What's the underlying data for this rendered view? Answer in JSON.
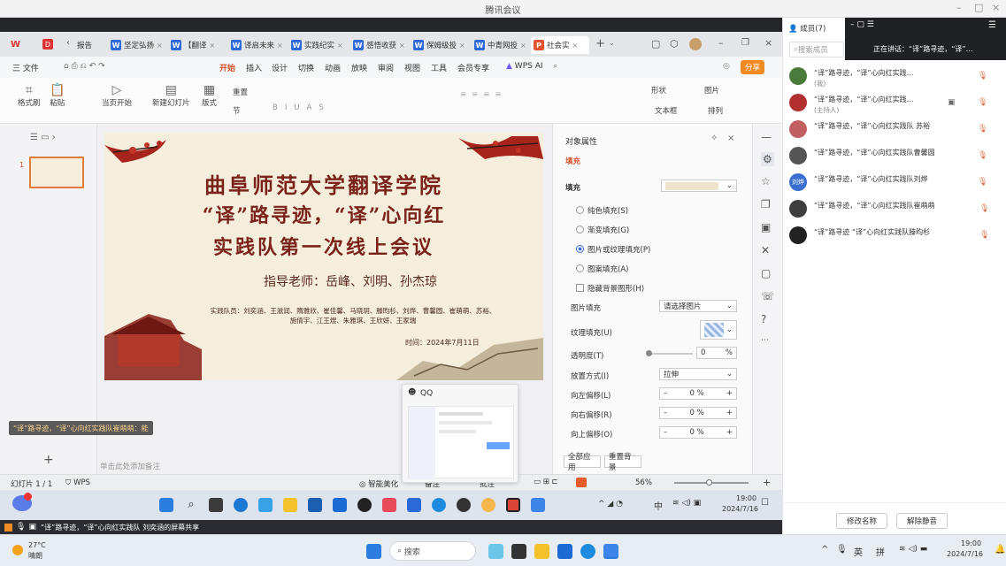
{
  "meeting": {
    "title": "腾讯会议",
    "controls": [
      "–",
      "□",
      "×"
    ]
  },
  "wps": {
    "tabs": [
      {
        "label": "报告",
        "icon": "w"
      },
      {
        "label": "坚定弘扬",
        "icon": "w"
      },
      {
        "label": "【翻译",
        "icon": "w"
      },
      {
        "label": "译启未来",
        "icon": "w"
      },
      {
        "label": "实践纪实",
        "icon": "w"
      },
      {
        "label": "感悟收获",
        "icon": "w"
      },
      {
        "label": "保姆级投",
        "icon": "w"
      },
      {
        "label": "中青网投",
        "icon": "w"
      },
      {
        "label": "社会实",
        "icon": "p"
      }
    ],
    "menus": [
      "开始",
      "插入",
      "设计",
      "切换",
      "动画",
      "放映",
      "审阅",
      "视图",
      "工具",
      "会员专享",
      "WPS AI"
    ],
    "file_menu": "三 文件",
    "share_button": "分享",
    "ribbon": {
      "format_painter": "格式刷",
      "paste": "粘贴",
      "play_from_start": "当页开始",
      "new_slide": "新建幻灯片",
      "layout": "版式",
      "section": "节",
      "reset": "重置",
      "shape": "形状",
      "picture": "图片",
      "textbox": "文本框",
      "arrange": "排列"
    },
    "slide": {
      "line1": "曲阜师范大学翻译学院",
      "line2": "“译”路寻迹，“译”心向红",
      "line3": "实践队第一次线上会议",
      "advisor": "指导老师：岳峰、刘明、孙杰琼",
      "members_line1": "实践队员：刘奕涵、王滋润、隋雅欣、崔佳馨、马晓玥、滕昀杉、刘烨、曹馨圆、崔萌萌、苏裕、",
      "members_line2": "施倩宇、江王煜、朱雅琪、王欣妍、王家瑞",
      "date": "时间：2024年7月11日",
      "number": "1"
    },
    "notes_placeholder": "单击此处添加备注",
    "status": {
      "slide": "幻灯片 1 / 1",
      "theme": "WPS",
      "beautify": "智能美化",
      "notes": "备注",
      "comments": "批注",
      "zoom": "56%"
    },
    "props": {
      "title": "对象属性",
      "tab": "填充",
      "fill_section": "填充",
      "options": [
        "纯色填充(S)",
        "渐变填充(G)",
        "图片或纹理填充(P)",
        "图案填充(A)"
      ],
      "selected": "图片或纹理填充(P)",
      "hide_bg": "隐藏背景图形(H)",
      "picture_fill": "图片填充",
      "picture_fill_value": "请选择图片",
      "texture_fill": "纹理填充(U)",
      "transparency": "透明度(T)",
      "transparency_value": "0",
      "transparency_unit": "%",
      "placement": "放置方式(I)",
      "placement_value": "拉伸",
      "offsets": [
        {
          "label": "向左偏移(L)",
          "value": "0 %"
        },
        {
          "label": "向右偏移(R)",
          "value": "0 %"
        },
        {
          "label": "向上偏移(O)",
          "value": "0 %"
        }
      ],
      "apply_all": "全部应用",
      "reset_bg": "重置背景"
    },
    "qq_popup": "QQ",
    "overlay_caption": "“译”路寻迹，“译”心向红实践队崔萌萌：能"
  },
  "shared_taskbar": {
    "time": "19:00",
    "date": "2024/7/16",
    "ime1": "中"
  },
  "share_strip": "“译”路寻迹，“译”心向红实践队 刘奕涵的屏幕共享",
  "panel": {
    "members_label": "成员(7)",
    "search_placeholder": "搜索成员",
    "speaking": "正在讲话：“译”路寻迹，“译”…",
    "members": [
      {
        "name": "“译”路寻迹，“译”心向红实践…",
        "role": "(我)",
        "color": "#4a7a3c"
      },
      {
        "name": "“译”路寻迹，“译”心向红实践…",
        "role": "(主持人)",
        "color": "#b23030"
      },
      {
        "name": "“译”路寻迹，“译”心向红实践队 苏裕",
        "role": "",
        "color": "#c06060"
      },
      {
        "name": "“译”路寻迹，“译”心向红实践队曹馨圆",
        "role": "",
        "color": "#555"
      },
      {
        "name": "“译”路寻迹，“译”心向红实践队刘烨",
        "role": "",
        "color": "#3a6fd0",
        "initials": "刘烨"
      },
      {
        "name": "“译”路寻迹，“译”心向红实践队崔萌萌",
        "role": "",
        "color": "#3e3e3e"
      },
      {
        "name": "“译”路寻迹 “译”心向红实践队滕昀杉",
        "role": "",
        "color": "#222"
      }
    ],
    "rename_button": "修改名称",
    "unmute_button": "解除静音"
  },
  "taskbar": {
    "weather_temp": "27°C",
    "weather_text": "晴朗",
    "search": "搜索",
    "lang": "英",
    "ime": "拼",
    "time": "19:00",
    "date": "2024/7/16"
  }
}
